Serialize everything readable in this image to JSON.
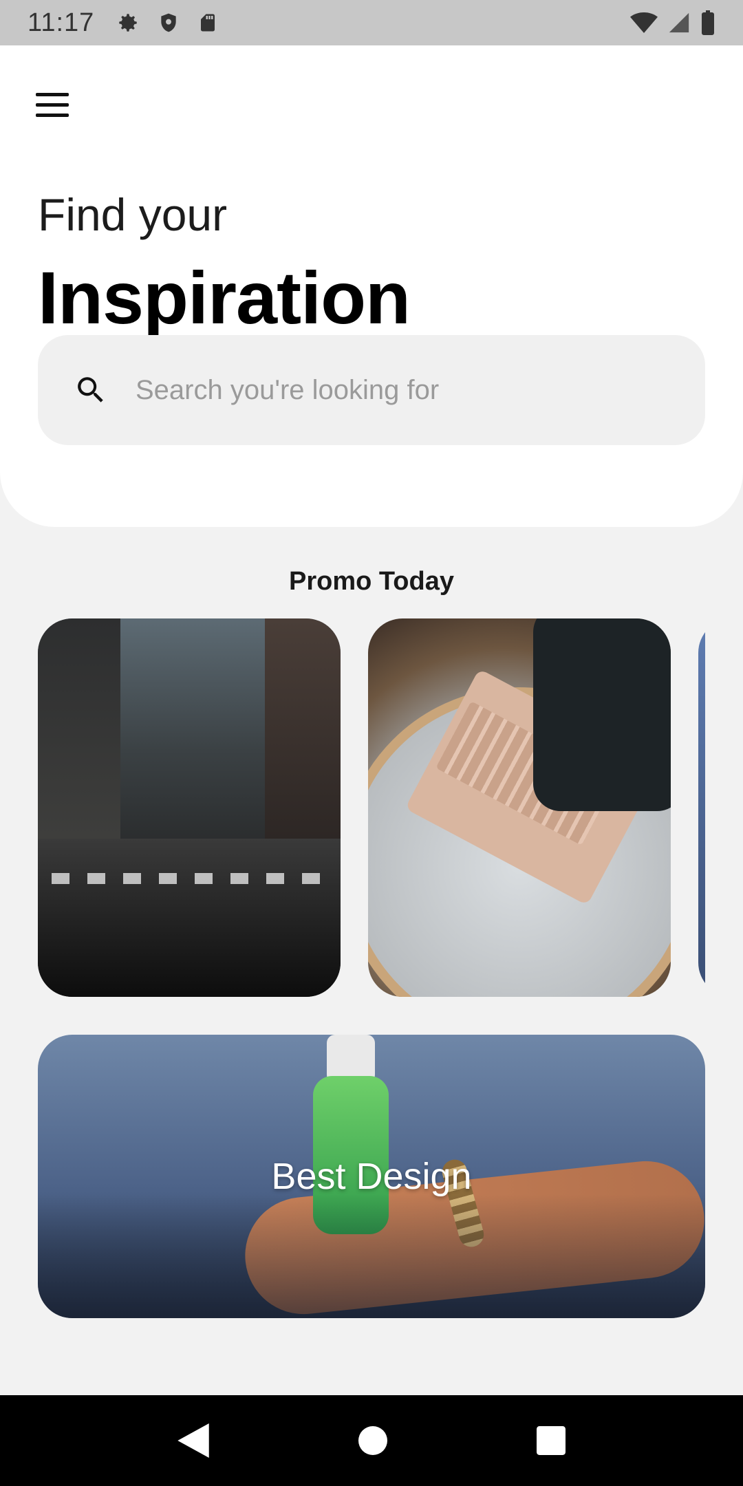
{
  "status_bar": {
    "time": "11:17",
    "left_icons": [
      "gear-icon",
      "shield-icon",
      "sd-card-icon"
    ],
    "right_icons": [
      "wifi-icon",
      "signal-icon",
      "battery-icon"
    ]
  },
  "header": {
    "menu_icon": "hamburger-menu-icon",
    "headline_small": "Find your",
    "headline_large": "Inspiration"
  },
  "search": {
    "placeholder": "Search you're looking for",
    "value": "",
    "icon": "search-icon"
  },
  "promo": {
    "title": "Promo Today",
    "cards": [
      {
        "image": "city-street-photo"
      },
      {
        "image": "laptop-hands-photo"
      },
      {
        "image": "blue-photo"
      }
    ]
  },
  "banner": {
    "label": "Best Design",
    "image": "hand-sanitizer-photo"
  },
  "nav_bar": {
    "buttons": [
      "back-icon",
      "home-icon",
      "recents-icon"
    ]
  },
  "colors": {
    "status_bar_bg": "#c7c7c7",
    "page_bg": "#f2f2f2",
    "card_bg": "#ffffff",
    "search_bg": "#f0f0f0",
    "nav_bar_bg": "#000000"
  }
}
